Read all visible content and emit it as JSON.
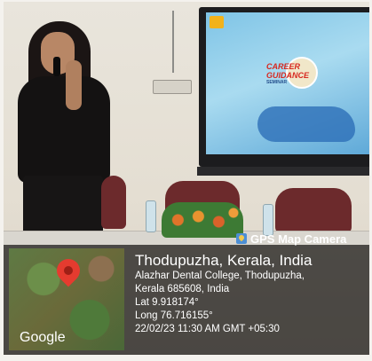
{
  "overlay": {
    "badge": "GPS Map Camera",
    "city": "Thodupuzha, Kerala, India",
    "address_line1": "Alazhar Dental College, Thodupuzha,",
    "address_line2": "Kerala 685608, India",
    "lat": "Lat 9.918174°",
    "long": "Long 76.716155°",
    "datetime": "22/02/23 11:30 AM GMT +05:30",
    "map_brand": "Google"
  },
  "screen": {
    "title_line1": "CAREER",
    "title_line2": "GUIDANCE",
    "title_small": "SEMINAR"
  },
  "colors": {
    "pin": "#e53b2f",
    "overlay": "#141211"
  }
}
